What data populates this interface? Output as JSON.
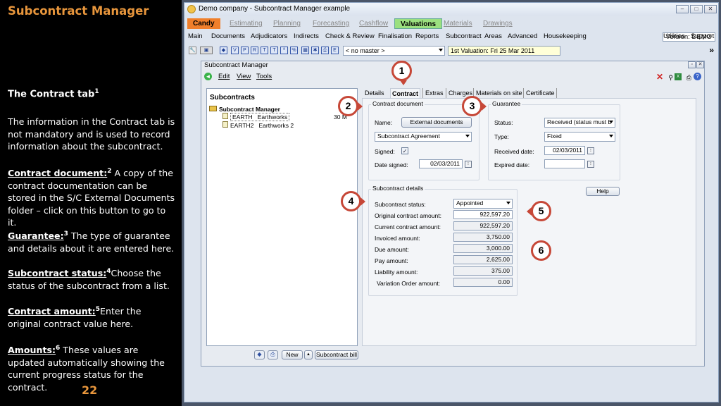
{
  "slide": {
    "heading": "Subcontract Manager",
    "contract_tab_title": "The Contract tab",
    "contract_tab_sup": "1",
    "intro": "The information in the Contract tab is not mandatory and is used to record information about the subcontract.",
    "doc_label": "Contract document:",
    "doc_sup": "2",
    "doc_text": " A copy of the contract documentation can be stored in the S/C External Documents folder – click on this button to go to it.",
    "guar_label": "Guarantee:",
    "guar_sup": "3",
    "guar_text": " The type of guarantee and details about it are entered here.",
    "status_label": "Subcontract status:",
    "status_sup": "4",
    "status_text": "Choose the status of the subcontract from a list.",
    "amount_label": "Contract amount:",
    "amount_sup": "5",
    "amount_text": "Enter the original contract value here.",
    "amounts_label": "Amounts:",
    "amounts_sup": "6",
    "amounts_text": " These values are updated automatically showing the current progress status for the contract.",
    "page_number": "22"
  },
  "app": {
    "window_title": "Demo company - Subcontract Manager example",
    "version": "Version: DEMO",
    "top_tabs": [
      "Candy",
      "Estimating",
      "Planning",
      "Forecasting",
      "Cashflow",
      "Valuations",
      "Materials",
      "Drawings"
    ],
    "menu": [
      "Main",
      "Documents",
      "Adjudicators",
      "Indirects",
      "Check & Review",
      "Finalisation",
      "Reports",
      "Subcontract",
      "Areas",
      "Advanced",
      "Housekeeping"
    ],
    "menu_right": [
      "Utilities",
      "Support"
    ],
    "master_combo": "< no master >",
    "valuation_combo": "1st Valuation: Fri 25 Mar 2011"
  },
  "inner": {
    "title": "Subcontract Manager",
    "menu": [
      "Edit",
      "View",
      "Tools"
    ],
    "tree_header": "Subcontracts",
    "tree_root": "Subcontract Manager",
    "tree_rows": [
      {
        "code": "EARTH",
        "name": "Earthworks",
        "extra": "30 M"
      },
      {
        "code": "EARTH2",
        "name": "Earthworks 2",
        "extra": ""
      }
    ],
    "tabs": [
      "Details",
      "Contract",
      "Extras",
      "Charges",
      "Materials on site",
      "Certificate"
    ],
    "bottom_new": "New",
    "bottom_bill": "Subcontract bill",
    "contract_doc": {
      "group": "Contract document",
      "name_label": "Name:",
      "ext_button": "External documents",
      "agreement": "Subcontract Agreement",
      "signed_label": "Signed:",
      "date_label": "Date signed:",
      "date_value": "02/03/2011"
    },
    "guarantee": {
      "group": "Guarantee",
      "status_label": "Status:",
      "status_value": "Received (status must b",
      "type_label": "Type:",
      "type_value": "Fixed",
      "received_label": "Received date:",
      "received_value": "02/03/2011",
      "expired_label": "Expired date:",
      "expired_value": ""
    },
    "details": {
      "group": "Subcontract details",
      "status_label": "Subcontract status:",
      "status_value": "Appointed",
      "rows": [
        {
          "label": "Original contract amount:",
          "value": "922,597.20"
        },
        {
          "label": "Current contract amount:",
          "value": "922,597.20"
        },
        {
          "label": "Invoiced amount:",
          "value": "3,750.00"
        },
        {
          "label": "Due amount:",
          "value": "3,000.00"
        },
        {
          "label": "Pay amount:",
          "value": "2,625.00"
        },
        {
          "label": "Liability amount:",
          "value": "375.00"
        },
        {
          "label": "Variation Order amount:",
          "value": "0.00"
        }
      ]
    },
    "help": "Help"
  },
  "callouts": [
    "1",
    "2",
    "3",
    "4",
    "5",
    "6"
  ]
}
